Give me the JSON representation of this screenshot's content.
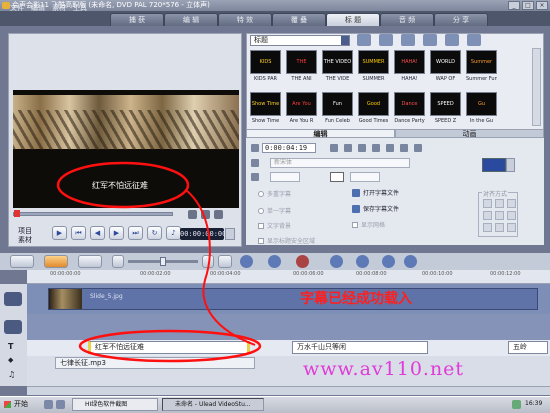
{
  "window": {
    "title": "会声会影11 飞酷高职版 (未命名, DVD PAL 720*576 - 立体声)"
  },
  "menu": [
    "文件",
    "编辑",
    "素材",
    "工具"
  ],
  "steps": [
    {
      "label": "捕 获"
    },
    {
      "label": "编 辑"
    },
    {
      "label": "特 效"
    },
    {
      "label": "覆 叠"
    },
    {
      "label": "标 题"
    },
    {
      "label": "音 频"
    },
    {
      "label": "分 享"
    }
  ],
  "preview": {
    "subtitle": "红军不怕远征难",
    "label_project": "项目",
    "label_clip": "素材",
    "timecode": "00:00:00:00"
  },
  "library": {
    "category": "标题",
    "items": [
      {
        "caption": "KIDS PAR",
        "art": "KIDS"
      },
      {
        "caption": "THE ANI",
        "art": "THE ANIMAL"
      },
      {
        "caption": "THE VIDE",
        "art": "THE VIDEO"
      },
      {
        "caption": "SUMMER",
        "art": "SUMMER FUN"
      },
      {
        "caption": "HAHA!",
        "art": "HAHA!"
      },
      {
        "caption": "WAP OF",
        "art": "WORLD"
      },
      {
        "caption": "Summer Fun",
        "art": "Summer"
      },
      {
        "caption": "Show Time",
        "art": "Show Time"
      },
      {
        "caption": "Are You R",
        "art": "Are You"
      },
      {
        "caption": "Fun Celeb",
        "art": "Fun"
      },
      {
        "caption": "Good Times",
        "art": "Good"
      },
      {
        "caption": "Dance Party",
        "art": "Dance"
      },
      {
        "caption": "SPEED Z",
        "art": "SPEED"
      },
      {
        "caption": "In the Gu",
        "art": "Gu"
      }
    ]
  },
  "edit": {
    "tab_edit": "编辑",
    "tab_anim": "动画",
    "timecode": "0:00:04:19",
    "font": "新宋体",
    "options": {
      "multi": "多重字幕",
      "single": "单一字幕",
      "text_bg": "文字背景",
      "safe": "显示标题安全区域",
      "open_sub": "打开字幕文件",
      "save_sub": "保存字幕文件",
      "show_mark": "显示网格",
      "align": "对齐方式"
    }
  },
  "timeline": {
    "ticks": [
      "00:00:00:00",
      "00:00:02:00",
      "00:00:04:00",
      "00:00:06:00",
      "00:00:08:00",
      "00:00:10:00",
      "00:00:12:00"
    ],
    "video_clip": "Slide_5.jpg",
    "subtitles": [
      "红军不怕远征难",
      "万水千山只等闲",
      "五岭"
    ],
    "music_clip": "七律长征.mp3"
  },
  "annotations": {
    "loaded": "字幕已经成功载入",
    "url": "www.av110.net"
  },
  "taskbar": {
    "start": "开始",
    "tasks": [
      "HI绿色软件截图",
      "未命名 - Ulead VideoStu...",
      ""
    ],
    "clock": "16:39"
  }
}
